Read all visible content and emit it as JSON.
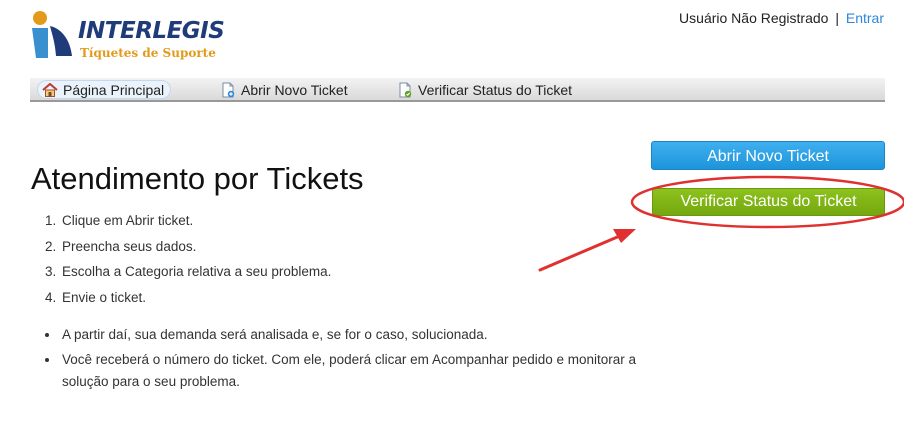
{
  "brand": {
    "name": "INTERLEGIS",
    "subtitle": "Tíquetes de Suporte"
  },
  "user": {
    "status": "Usuário Não Registrado",
    "separator": "|",
    "login_label": "Entrar"
  },
  "nav": {
    "items": [
      {
        "label": "Página Principal",
        "icon": "home-icon"
      },
      {
        "label": "Abrir Novo Ticket",
        "icon": "new-ticket-icon"
      },
      {
        "label": "Verificar Status do Ticket",
        "icon": "ticket-status-icon"
      }
    ]
  },
  "main": {
    "title": "Atendimento por Tickets",
    "steps": [
      "Clique em Abrir ticket.",
      "Preencha seus dados.",
      "Escolha a Categoria relativa a seu problema.",
      "Envie o ticket."
    ],
    "notes": [
      "A partir daí, sua demanda será analisada e, se for o caso, solucionada.",
      "Você receberá o número do ticket. Com ele, poderá clicar em Acompanhar pedido e monitorar a solução para o seu problema."
    ]
  },
  "actions": {
    "open_ticket": "Abrir Novo Ticket",
    "check_status": "Verificar Status do Ticket"
  },
  "colors": {
    "accent_blue": "#2f86d8",
    "button_blue": "#1d95db",
    "button_green": "#7ab313",
    "annotation_red": "#e03030",
    "logo_navy": "#1f3b7a",
    "logo_orange": "#e39a1a"
  }
}
